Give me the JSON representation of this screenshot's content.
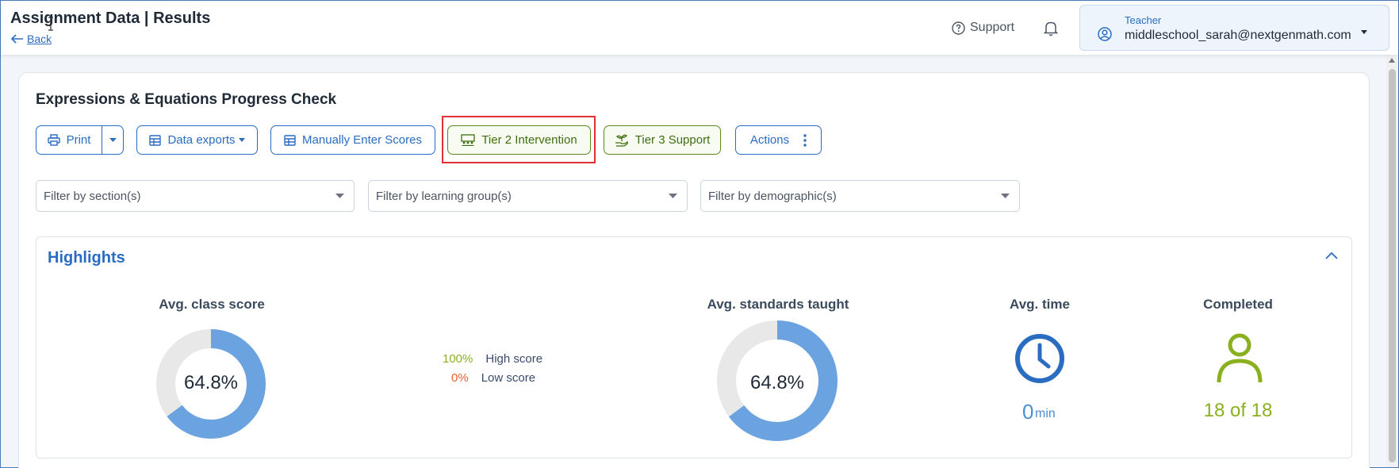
{
  "header": {
    "title": "Assignment Data | Results",
    "back_label": "Back",
    "support_label": "Support",
    "user_role": "Teacher",
    "user_email": "middleschool_sarah@nextgenmath.com"
  },
  "assignment": {
    "title": "Expressions & Equations Progress Check"
  },
  "toolbar": {
    "print_label": "Print",
    "data_exports_label": "Data exports",
    "manual_scores_label": "Manually Enter Scores",
    "tier2_label": "Tier 2 Intervention",
    "tier3_label": "Tier 3 Support",
    "actions_label": "Actions"
  },
  "filters": {
    "section_placeholder": "Filter by section(s)",
    "learning_group_placeholder": "Filter by learning group(s)",
    "demographic_placeholder": "Filter by demographic(s)"
  },
  "highlights": {
    "title": "Highlights",
    "avg_class_score": {
      "label": "Avg. class score",
      "value_text": "64.8%",
      "fraction": 0.648
    },
    "score_range": {
      "high_value": "100%",
      "high_label": "High score",
      "low_value": "0%",
      "low_label": "Low score"
    },
    "avg_standards_taught": {
      "label": "Avg. standards taught",
      "value_text": "64.8%",
      "fraction": 0.648
    },
    "avg_time": {
      "label": "Avg. time",
      "value": "0",
      "unit": "min"
    },
    "completed": {
      "label": "Completed",
      "value": "18 of 18"
    }
  },
  "colors": {
    "accent": "#2a6cc2",
    "donut_fill": "#6aa3e0",
    "donut_track": "#e8e8e8",
    "high_score": "#8ab020",
    "low_score": "#e8612c",
    "tier_green": "#3e6e10",
    "highlight_red": "#e03232"
  }
}
